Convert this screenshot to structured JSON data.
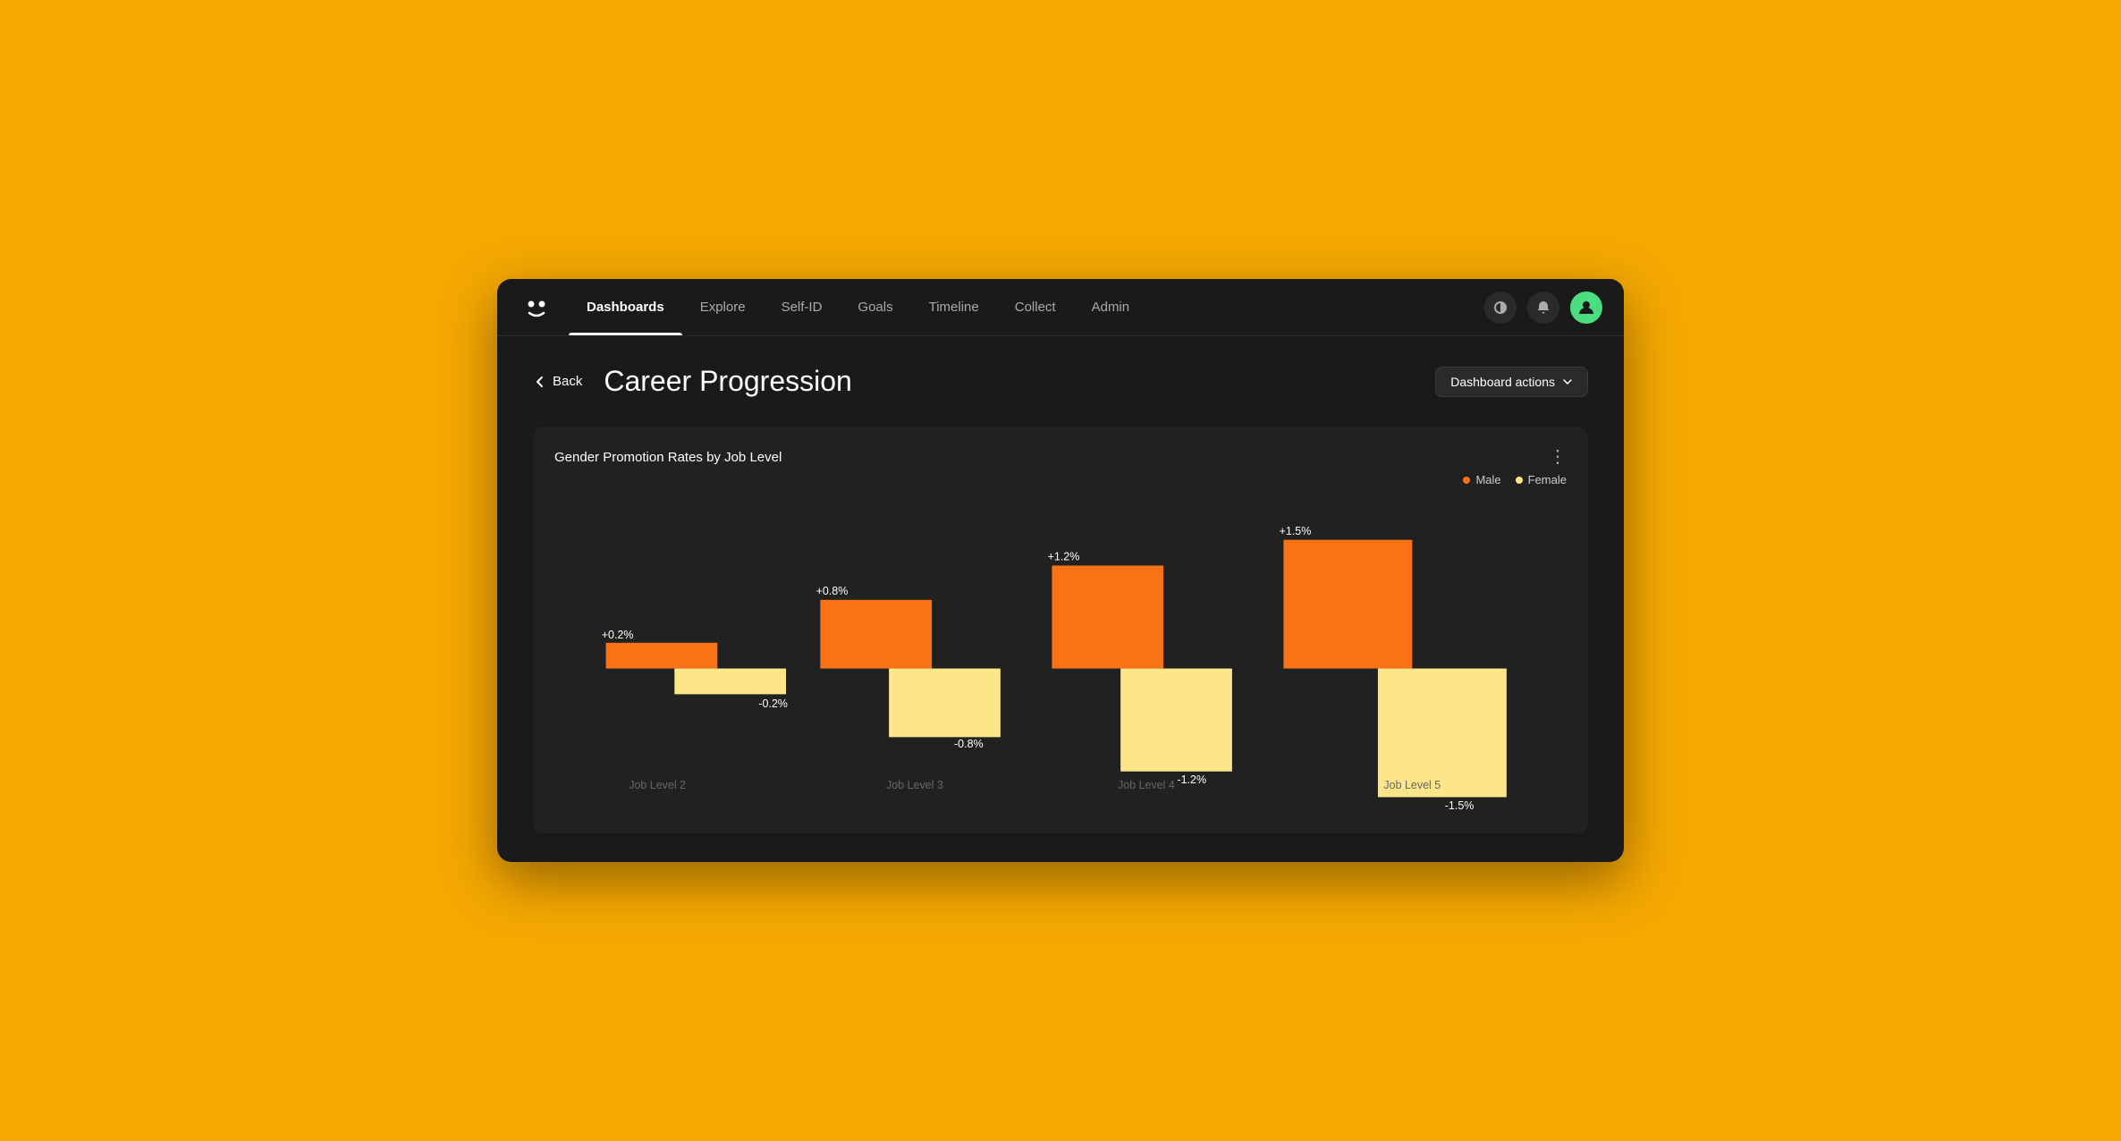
{
  "nav": {
    "items": [
      {
        "label": "Dashboards",
        "active": true
      },
      {
        "label": "Explore",
        "active": false
      },
      {
        "label": "Self-ID",
        "active": false
      },
      {
        "label": "Goals",
        "active": false
      },
      {
        "label": "Timeline",
        "active": false
      },
      {
        "label": "Collect",
        "active": false
      },
      {
        "label": "Admin",
        "active": false
      }
    ]
  },
  "header": {
    "back_label": "Back",
    "page_title": "Career Progression",
    "actions_label": "Dashboard actions"
  },
  "chart": {
    "title": "Gender Promotion Rates by Job Level",
    "legend": [
      {
        "label": "Male",
        "color": "#F97316"
      },
      {
        "label": "Female",
        "color": "#FDE68A"
      }
    ],
    "bars": [
      {
        "job_level": "Job Level 2",
        "male_value": "+0.2%",
        "female_value": "-0.2%"
      },
      {
        "job_level": "Job Level 3",
        "male_value": "+0.8%",
        "female_value": "-0.8%"
      },
      {
        "job_level": "Job Level 4",
        "male_value": "+1.2%",
        "female_value": "-1.2%"
      },
      {
        "job_level": "Job Level 5",
        "male_value": "+1.5%",
        "female_value": "-1.5%"
      }
    ]
  },
  "colors": {
    "male": "#F97316",
    "female": "#FDE68A",
    "bg": "#1a1a1a",
    "card_bg": "#212121"
  }
}
